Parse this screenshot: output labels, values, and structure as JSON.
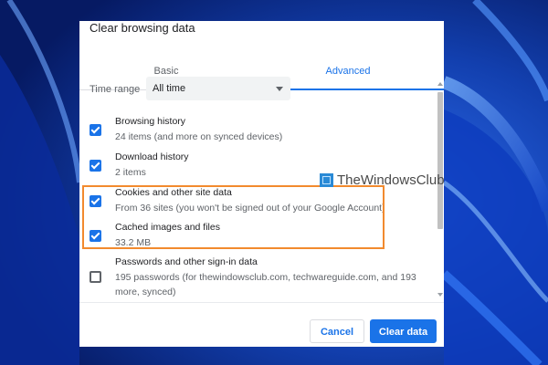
{
  "dialog": {
    "title": "Clear browsing data",
    "tabs": [
      {
        "label": "Basic",
        "selected": false
      },
      {
        "label": "Advanced",
        "selected": true
      }
    ],
    "time_range": {
      "label": "Time range",
      "value": "All time"
    },
    "items": [
      {
        "title": "Browsing history",
        "subtitle": "24 items (and more on synced devices)",
        "checked": true
      },
      {
        "title": "Download history",
        "subtitle": "2 items",
        "checked": true
      },
      {
        "title": "Cookies and other site data",
        "subtitle": "From 36 sites (you won't be signed out of your Google Account)",
        "checked": true
      },
      {
        "title": "Cached images and files",
        "subtitle": "33.2 MB",
        "checked": true
      },
      {
        "title": "Passwords and other sign-in data",
        "subtitle_line1": "195 passwords (for thewindowsclub.com, techwareguide.com, and 193",
        "subtitle_line2": "more, synced)",
        "checked": false
      }
    ],
    "buttons": {
      "cancel": "Cancel",
      "clear": "Clear data"
    }
  },
  "watermark": {
    "text": "TheWindowsClub"
  },
  "colors": {
    "accent": "#1a73e8",
    "highlight": "#f28a2e",
    "wallpaper": "#0b2a8f"
  }
}
